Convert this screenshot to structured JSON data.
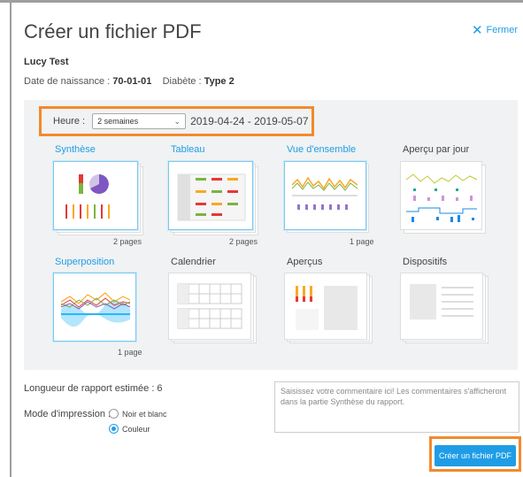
{
  "dialog": {
    "title": "Créer un fichier PDF",
    "close_label": "Fermer"
  },
  "patient": {
    "name": "Lucy Test",
    "dob_label": "Date de naissance :",
    "dob_value": "70-01-01",
    "diabetes_label": "Diabète :",
    "diabetes_value": "Type 2"
  },
  "time": {
    "label": "Heure :",
    "selected": "2 semaines",
    "range": "2019-04-24 - 2019-05-07"
  },
  "reports": [
    {
      "title": "Synthèse",
      "selected": true,
      "pages": "2 pages"
    },
    {
      "title": "Tableau",
      "selected": true,
      "pages": "2 pages"
    },
    {
      "title": "Vue d'ensemble",
      "selected": true,
      "pages": "1 page"
    },
    {
      "title": "Aperçu par jour",
      "selected": false,
      "pages": ""
    },
    {
      "title": "Superposition",
      "selected": true,
      "pages": "1 page"
    },
    {
      "title": "Calendrier",
      "selected": false,
      "pages": ""
    },
    {
      "title": "Aperçus",
      "selected": false,
      "pages": ""
    },
    {
      "title": "Dispositifs",
      "selected": false,
      "pages": ""
    }
  ],
  "report_length": "Longueur de rapport estimée : 6",
  "print_mode": {
    "label": "Mode d'impression :",
    "options": [
      "Noir et blanc",
      "Couleur"
    ],
    "selected": "Couleur"
  },
  "comment_placeholder": "Saisissez votre commentaire ici! Les commentaires s'afficheront dans la partie Synthèse du rapport.",
  "create_button": "Créer un fichier PDF",
  "colors": {
    "accent": "#1e9de6",
    "highlight": "#f28a2c",
    "panel": "#f0f2f3"
  }
}
